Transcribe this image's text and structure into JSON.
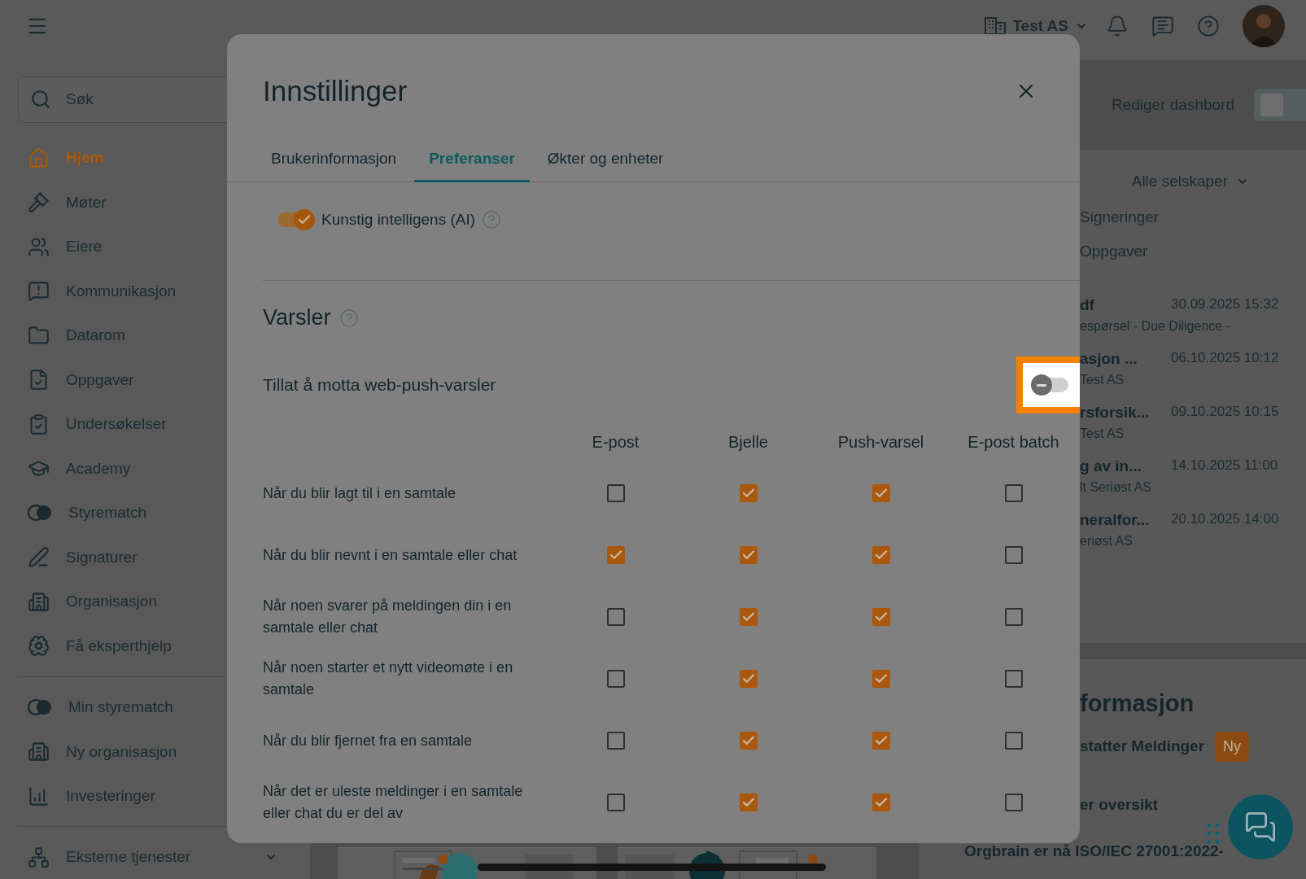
{
  "topbar": {
    "company": "Test AS"
  },
  "sidebar": {
    "search": {
      "placeholder": "Søk"
    },
    "items": [
      {
        "label": "Hjem",
        "selected": true
      },
      {
        "label": "Møter",
        "selected": false
      },
      {
        "label": "Eiere",
        "selected": false
      },
      {
        "label": "Kommunikasjon",
        "selected": false
      },
      {
        "label": "Datarom",
        "selected": false
      },
      {
        "label": "Oppgaver",
        "selected": false
      },
      {
        "label": "Undersøkelser",
        "selected": false
      },
      {
        "label": "Academy",
        "selected": false
      },
      {
        "label": "Styrematch",
        "selected": false
      },
      {
        "label": "Signaturer",
        "selected": false
      },
      {
        "label": "Organisasjon",
        "selected": false
      },
      {
        "label": "Få eksperthjelp",
        "selected": false
      }
    ],
    "secondary_items": [
      {
        "label": "Min styrematch",
        "selected": false
      },
      {
        "label": "Ny organisasjon",
        "selected": false
      },
      {
        "label": "Investeringer",
        "selected": false
      }
    ],
    "footer_item": {
      "label": "Eksterne tjenester"
    }
  },
  "dashboard": {
    "edit_label": "Rediger dashbord",
    "edit_on": false,
    "company_filter": "Alle selskaper",
    "tabs": [
      "Signeringer",
      "Oppgaver"
    ],
    "events": [
      {
        "title": "df",
        "date": "30.09.2025 15:32",
        "subtitle": "espørsel - Due Diligence -"
      },
      {
        "title": "asjon ...",
        "date": "06.10.2025 10:12",
        "subtitle": "Test AS"
      },
      {
        "title": "rsforsik...",
        "date": "09.10.2025 10:15",
        "subtitle": "Test AS"
      },
      {
        "title": "g av in...",
        "date": "14.10.2025 11:00",
        "subtitle": "lt Seriøst AS"
      },
      {
        "title": "neralfor...",
        "date": "20.10.2025 14:00",
        "subtitle": "eriøst AS"
      }
    ],
    "info": {
      "heading": "formasjon",
      "items": [
        {
          "title": "statter Meldinger",
          "badge": "Ny"
        },
        {
          "title": "er oversikt"
        }
      ],
      "news": "Orgbrain er nå ISO/IEC 27001:2022-"
    }
  },
  "dialog": {
    "title": "Innstillinger",
    "tabs": [
      {
        "label": "Brukerinformasjon",
        "selected": false
      },
      {
        "label": "Preferanser",
        "selected": true
      },
      {
        "label": "Økter og enheter",
        "selected": false
      }
    ],
    "ai_toggle": {
      "label": "Kunstig intelligens (AI)",
      "on": true
    },
    "notifications": {
      "heading": "Varsler",
      "web_push": {
        "label": "Tillat å motta web-push-varsler",
        "on": false,
        "highlighted": true
      },
      "columns": [
        "E-post",
        "Bjelle",
        "Push-varsel",
        "E-post batch"
      ],
      "rows": [
        {
          "label": "Når du blir lagt til i en samtale",
          "checks": [
            false,
            true,
            true,
            false
          ]
        },
        {
          "label": "Når du blir nevnt i en samtale eller chat",
          "checks": [
            true,
            true,
            true,
            false
          ]
        },
        {
          "label": "Når noen svarer på meldingen din i en samtale eller chat",
          "checks": [
            false,
            true,
            true,
            false
          ]
        },
        {
          "label": "Når noen starter et nytt videomøte i en samtale",
          "checks": [
            false,
            true,
            true,
            false
          ]
        },
        {
          "label": "Når du blir fjernet fra en samtale",
          "checks": [
            false,
            true,
            true,
            false
          ]
        },
        {
          "label": "Når det er uleste meldinger i en samtale eller chat du er del av",
          "checks": [
            false,
            true,
            true,
            false
          ]
        }
      ]
    }
  }
}
